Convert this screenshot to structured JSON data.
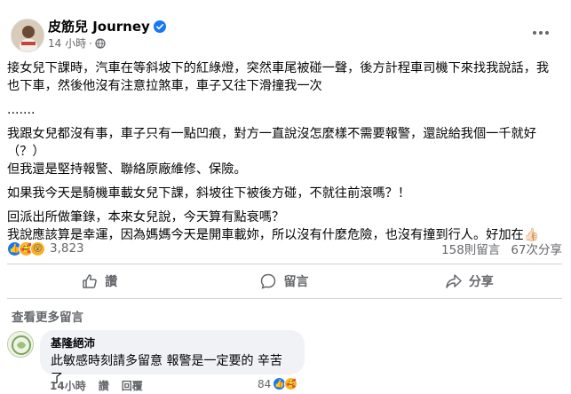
{
  "post": {
    "author": "皮筋兒 Journey",
    "time": "14 小時",
    "time_sep": "·",
    "paragraphs": [
      "接女兒下課時，汽車在等斜坡下的紅綠燈，突然車尾被碰一聲，後方計程車司機下來找我說話，我也下車，然後他沒有注意拉煞車，車子又往下滑撞我一次",
      ".......",
      "我跟女兒都沒有事，車子只有一點凹痕，對方一直說沒怎麼樣不需要報警，還說給我個一千就好（？）\n但我還是堅持報警、聯絡原廠維修、保險。",
      "如果我今天是騎機車載女兒下課，斜坡往下被後方碰，不就往前滾嗎？！",
      "回派出所做筆錄，本來女兒說，今天算有點衰嗎？\n我說應該算是幸運，因為媽媽今天是開車載妳，所以沒有什麼危險，也沒有撞到行人。好加在👍🏻"
    ]
  },
  "engagement": {
    "reaction_count": "3,823",
    "comments": "158則留言",
    "shares": "67次分享"
  },
  "actions": {
    "like": "讚",
    "comment": "留言",
    "share": "分享"
  },
  "comments_section": {
    "more_label": "查看更多留言",
    "items": [
      {
        "name": "基隆絕沛",
        "text": "此敏感時刻請多留意 報警是一定要的 辛苦了",
        "time": "14小時",
        "like": "讚",
        "reply": "回覆",
        "reaction_count": "84"
      }
    ]
  },
  "colors": {
    "accent": "#1877f2",
    "secondary_text": "#65676b",
    "bubble": "#f0f2f5"
  }
}
